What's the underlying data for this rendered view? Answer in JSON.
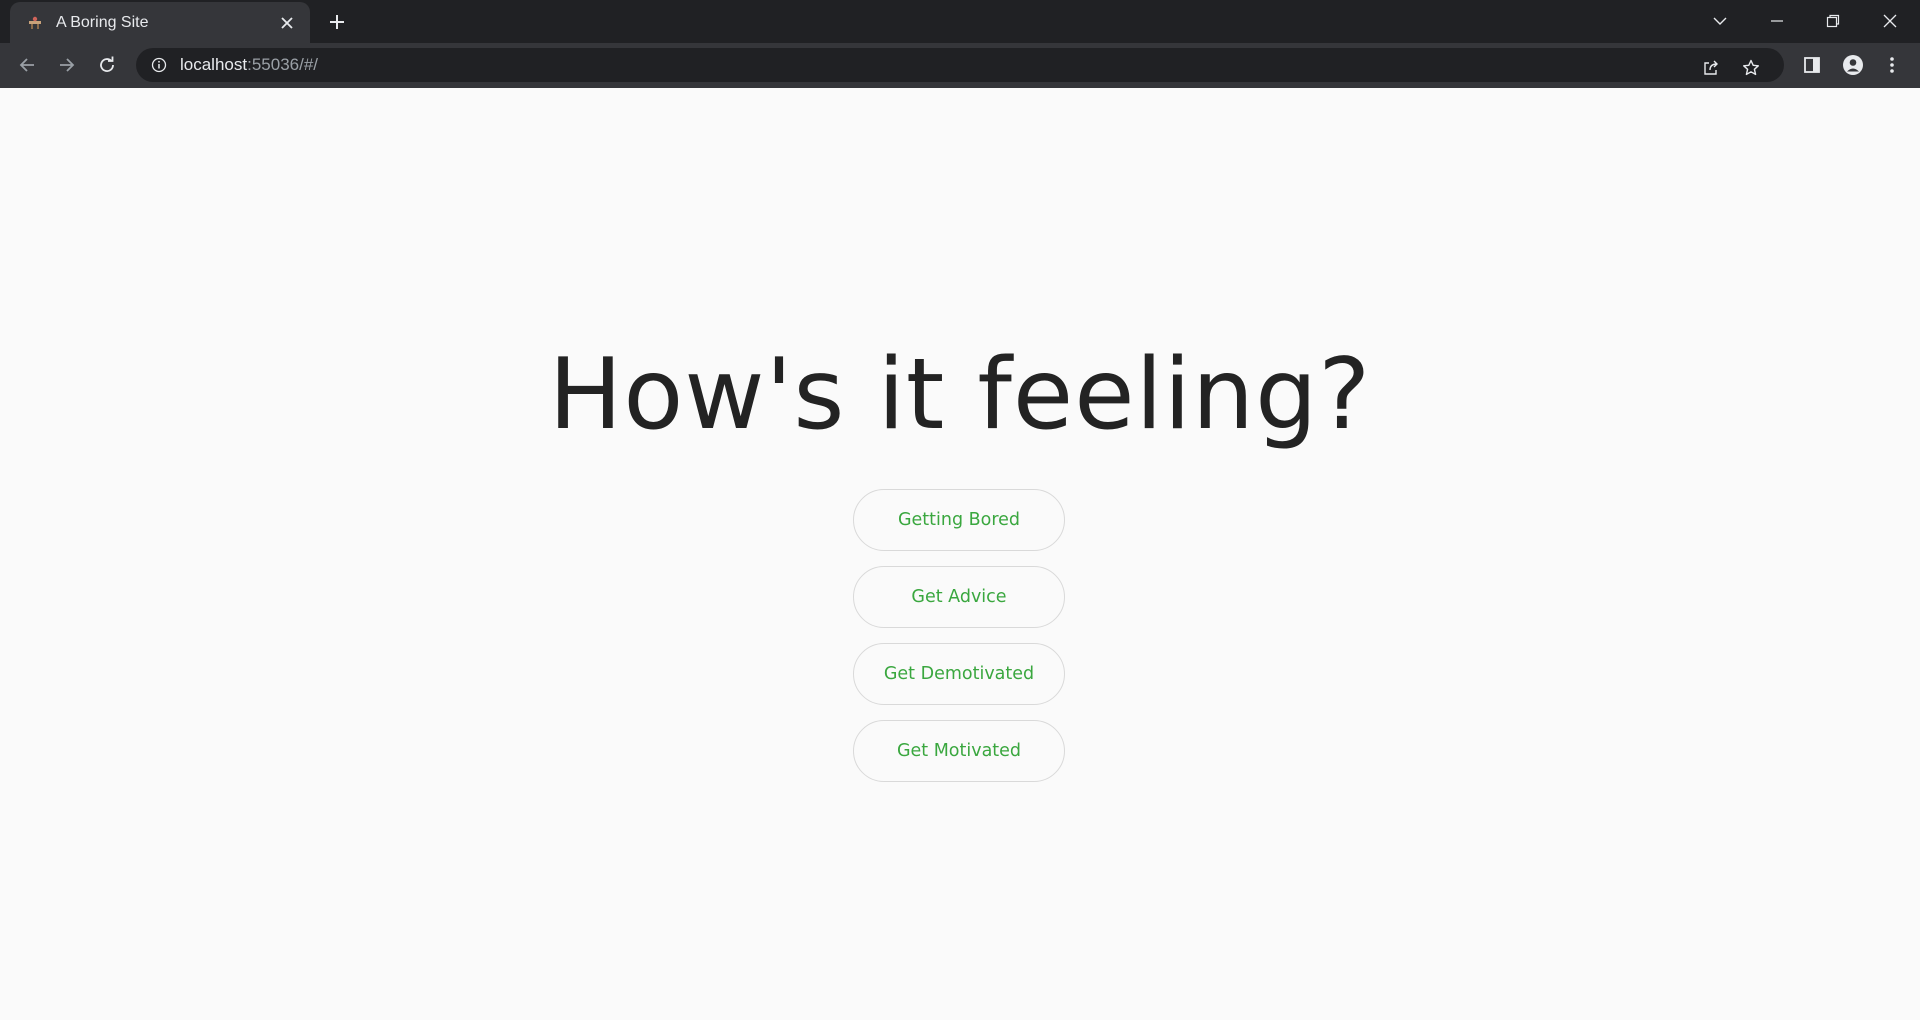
{
  "browser": {
    "tab_title": "A Boring Site",
    "url_host": "localhost",
    "url_rest": ":55036/#/"
  },
  "icons": {
    "favicon": "site-favicon-icon",
    "tab_close": "close-icon",
    "new_tab": "plus-icon",
    "back": "arrow-left-icon",
    "forward": "arrow-right-icon",
    "reload": "reload-icon",
    "site_info": "info-icon",
    "share": "share-icon",
    "bookmark": "star-icon",
    "side_panel": "side-panel-icon",
    "profile": "profile-icon",
    "menu": "kebab-menu-icon"
  },
  "main": {
    "heading": "How's it feeling?",
    "buttons": [
      {
        "label": "Getting Bored"
      },
      {
        "label": "Get Advice"
      },
      {
        "label": "Get Demotivated"
      },
      {
        "label": "Get Motivated"
      }
    ]
  },
  "colors": {
    "accent": "#3aa73f",
    "heading": "#232323",
    "page_bg": "#fafafa",
    "chrome_dark": "#202124",
    "chrome_toolbar": "#35363a"
  }
}
